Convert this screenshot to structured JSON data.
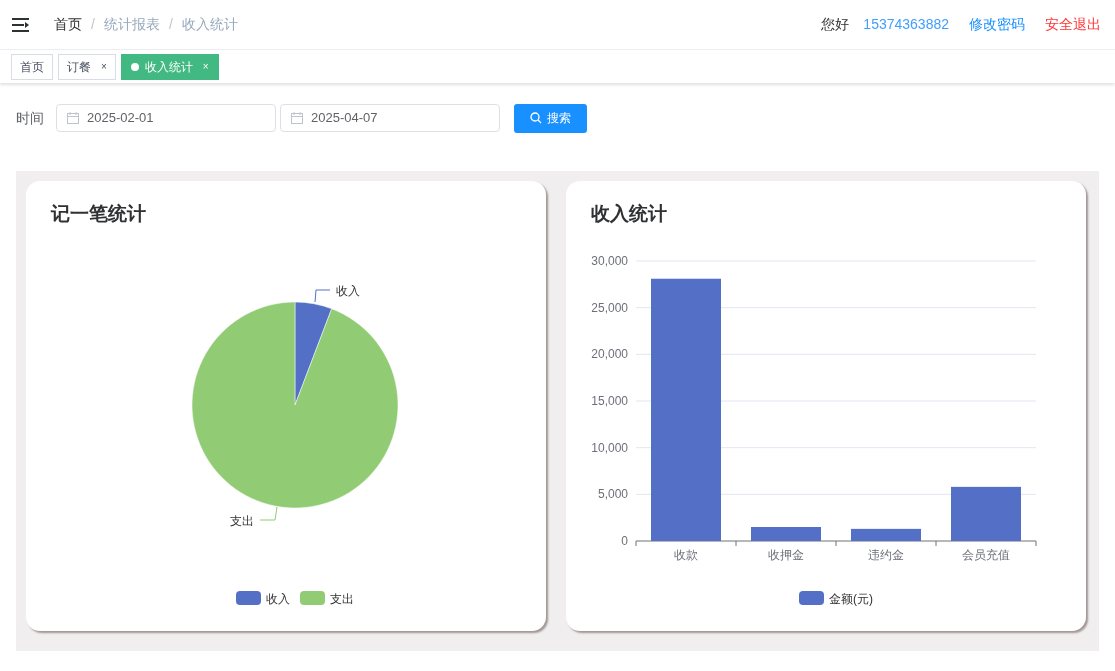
{
  "header": {
    "breadcrumb": [
      {
        "label": "首页",
        "current": false
      },
      {
        "label": "统计报表",
        "current": true
      },
      {
        "label": "收入统计",
        "current": true
      }
    ],
    "separator": "/",
    "greeting": "您好",
    "phone": "15374363882",
    "change_password": "修改密码",
    "logout": "安全退出"
  },
  "tabs": [
    {
      "label": "首页",
      "selected": false
    },
    {
      "label": "订餐",
      "selected": false,
      "close": "×"
    },
    {
      "label": "收入统计",
      "selected": true,
      "close": "×"
    }
  ],
  "filter": {
    "label": "时间",
    "start_date": "2025-02-01",
    "end_date": "2025-04-07",
    "search_button": "搜索"
  },
  "pie_card": {
    "title": "记一笔统计",
    "slices": [
      {
        "label": "收入",
        "color": "#5470c6"
      },
      {
        "label": "支出",
        "color": "#91cc75"
      }
    ],
    "legend": [
      {
        "label": "收入",
        "color": "#5470c6"
      },
      {
        "label": "支出",
        "color": "#91cc75"
      }
    ]
  },
  "bar_card": {
    "title": "收入统计",
    "chart_data": {
      "type": "bar",
      "categories": [
        "收款",
        "收押金",
        "违约金",
        "会员充值"
      ],
      "series": [
        {
          "name": "金额(元)",
          "color": "#5470c6",
          "values": [
            28100,
            1500,
            1300,
            5800
          ]
        }
      ],
      "grid": true,
      "ylim": [
        0,
        30000
      ],
      "yticks": [
        {
          "value": 0,
          "label": "0"
        },
        {
          "value": 5000,
          "label": "5,000"
        },
        {
          "value": 10000,
          "label": "10,000"
        },
        {
          "value": 15000,
          "label": "15,000"
        },
        {
          "value": 20000,
          "label": "20,000"
        },
        {
          "value": 25000,
          "label": "25,000"
        },
        {
          "value": 30000,
          "label": "30,000"
        }
      ]
    }
  }
}
